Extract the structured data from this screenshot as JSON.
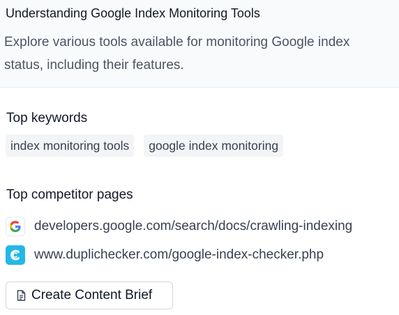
{
  "header": {
    "title": "Understanding Google Index Monitoring Tools",
    "description": "Explore various tools available for monitoring Google index status, including their features."
  },
  "keywords": {
    "label": "Top keywords",
    "items": [
      "index monitoring tools",
      "google index monitoring"
    ]
  },
  "competitors": {
    "label": "Top competitor pages",
    "items": [
      {
        "url": "developers.google.com/search/docs/crawling-indexing",
        "icon": "google-favicon-icon"
      },
      {
        "url": "www.duplichecker.com/google-index-checker.php",
        "icon": "duplichecker-favicon-icon"
      }
    ]
  },
  "actions": {
    "create_brief_label": "Create Content Brief",
    "create_brief_icon": "document-icon"
  },
  "colors": {
    "header_bg": "#f9fafb",
    "chip_bg": "#f3f4f6",
    "duplichecker_brand": "#22b8e6"
  }
}
